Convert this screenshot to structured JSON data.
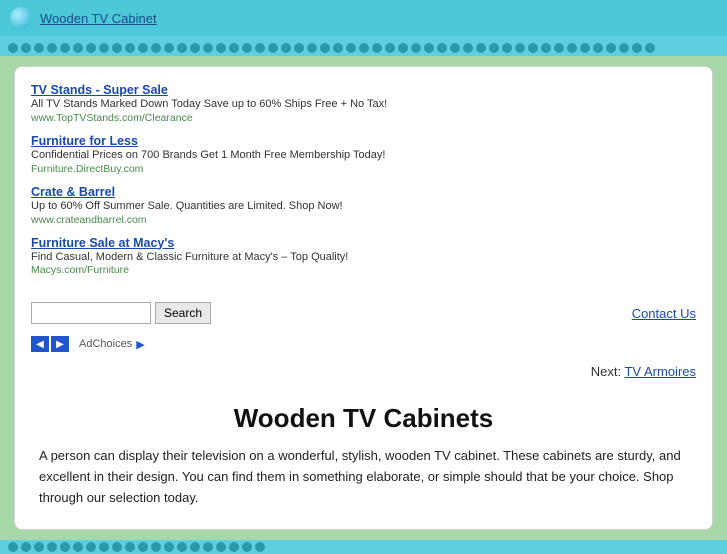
{
  "topBar": {
    "title": "Wooden TV Cabinet"
  },
  "ads": [
    {
      "title": "TV Stands - Super Sale",
      "desc": "All TV Stands Marked Down Today Save up to 60% Ships Free + No Tax!",
      "url": "www.TopTVStands.com/Clearance"
    },
    {
      "title": "Furniture for Less",
      "desc": "Confidential Prices on 700 Brands Get 1 Month Free Membership Today!",
      "url": "Furniture.DirectBuy.com"
    },
    {
      "title": "Crate & Barrel",
      "desc": "Up to 60% Off Summer Sale. Quantities are Limited. Shop Now!",
      "url": "www.crateandbarrel.com"
    },
    {
      "title": "Furniture Sale at Macy's",
      "desc": "Find Casual, Modern & Classic Furniture at Macy's – Top Quality!",
      "url": "Macys.com/Furniture"
    }
  ],
  "search": {
    "placeholder": "",
    "buttonLabel": "Search"
  },
  "contactUs": "Contact Us",
  "adChoices": "AdChoices",
  "next": {
    "label": "Next:",
    "linkText": "TV Armoires"
  },
  "pageTitle": "Wooden TV Cabinets",
  "bodyText": "A person can display their television on a wonderful, stylish, wooden TV cabinet. These cabinets are sturdy, and excellent in their design. You can find them in something elaborate, or simple should that be your choice. Shop through our selection today.",
  "navPrev": "◀",
  "navNext": "▶"
}
